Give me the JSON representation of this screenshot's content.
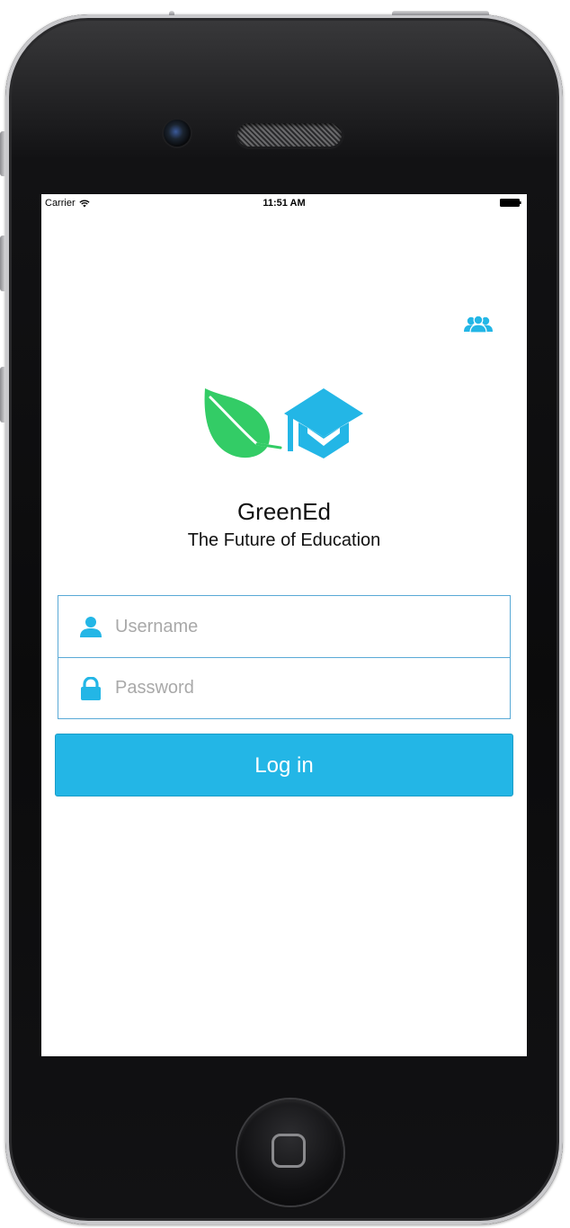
{
  "status_bar": {
    "carrier": "Carrier",
    "time": "11:51 AM",
    "wifi_icon": "wifi-icon",
    "battery_icon": "battery-icon"
  },
  "header": {
    "users_icon": "users-icon"
  },
  "brand": {
    "logo_icons": [
      "leaf-icon",
      "graduation-cap-icon"
    ],
    "app_name": "GreenEd",
    "tagline": "The Future of Education",
    "leaf_color": "#33cc66",
    "accent_color": "#23b6e6"
  },
  "login_form": {
    "username": {
      "placeholder": "Username",
      "value": "",
      "icon": "user-icon"
    },
    "password": {
      "placeholder": "Password",
      "value": "",
      "icon": "lock-icon"
    },
    "submit_label": "Log in"
  }
}
